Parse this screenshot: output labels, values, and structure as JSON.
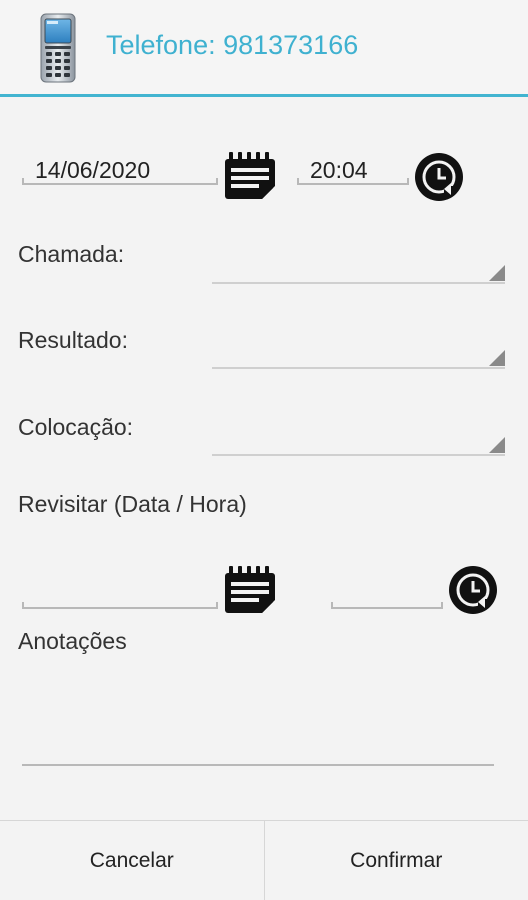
{
  "header": {
    "title": "Telefone: 981373166",
    "icon": "mobile-phone-icon"
  },
  "call_date": {
    "value": "14/06/2020",
    "icon": "calendar-icon"
  },
  "call_time": {
    "value": "20:04",
    "icon": "clock-icon"
  },
  "fields": {
    "chamada_label": "Chamada:",
    "chamada_value": "",
    "resultado_label": "Resultado:",
    "resultado_value": "",
    "colocacao_label": "Colocação:",
    "colocacao_value": ""
  },
  "revisit": {
    "label": "Revisitar (Data / Hora)",
    "date_value": "",
    "time_value": ""
  },
  "notes": {
    "label": "Anotações",
    "value": ""
  },
  "footer": {
    "cancel_label": "Cancelar",
    "confirm_label": "Confirmar"
  },
  "colors": {
    "accent": "#3fb1d0",
    "divider": "#42b4d0"
  }
}
